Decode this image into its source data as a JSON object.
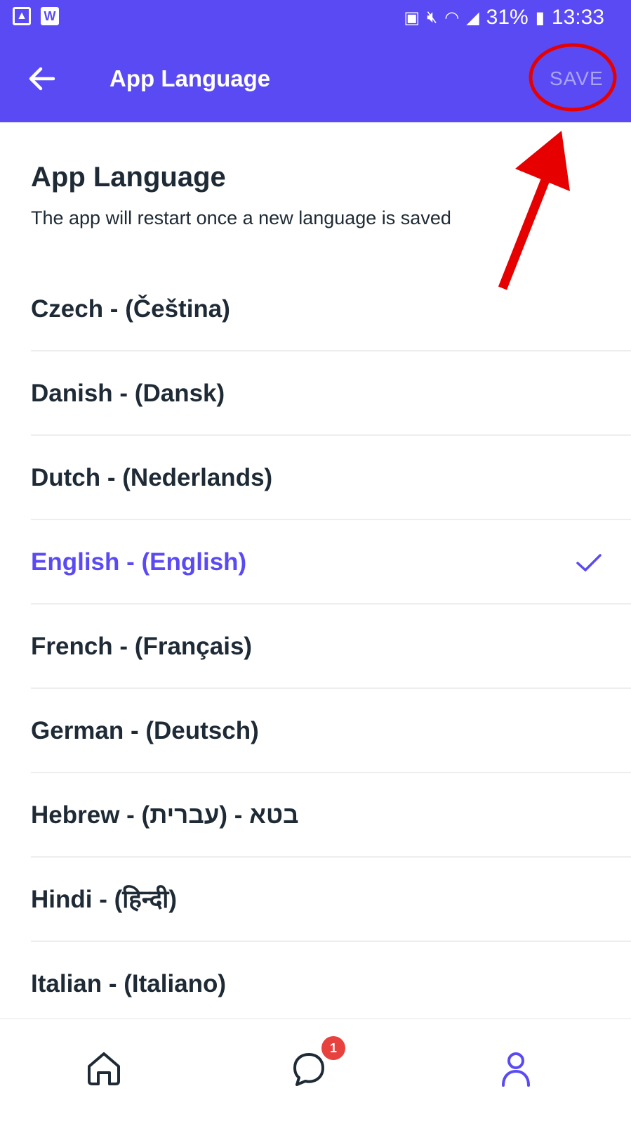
{
  "status_bar": {
    "battery": "31%",
    "time": "13:33"
  },
  "app_bar": {
    "title": "App Language",
    "save_label": "SAVE"
  },
  "header": {
    "title": "App Language",
    "subtitle": "The app will restart once a new language is saved"
  },
  "languages": [
    {
      "label": "Czech - (Čeština)"
    },
    {
      "label": "Danish - (Dansk)"
    },
    {
      "label": "Dutch - (Nederlands)"
    },
    {
      "label": "English - (English)",
      "selected": true
    },
    {
      "label": "French - (Français)"
    },
    {
      "label": "German - (Deutsch)"
    },
    {
      "label": "Hebrew - (עברית) - בטא"
    },
    {
      "label": "Hindi - (हिन्दी)"
    },
    {
      "label": "Italian - (Italiano)"
    }
  ],
  "bottom_nav": {
    "chat_badge": "1"
  },
  "colors": {
    "primary": "#5a4af4",
    "text": "#1e2a35",
    "annotation": "#e60000",
    "badge": "#e8423f"
  }
}
